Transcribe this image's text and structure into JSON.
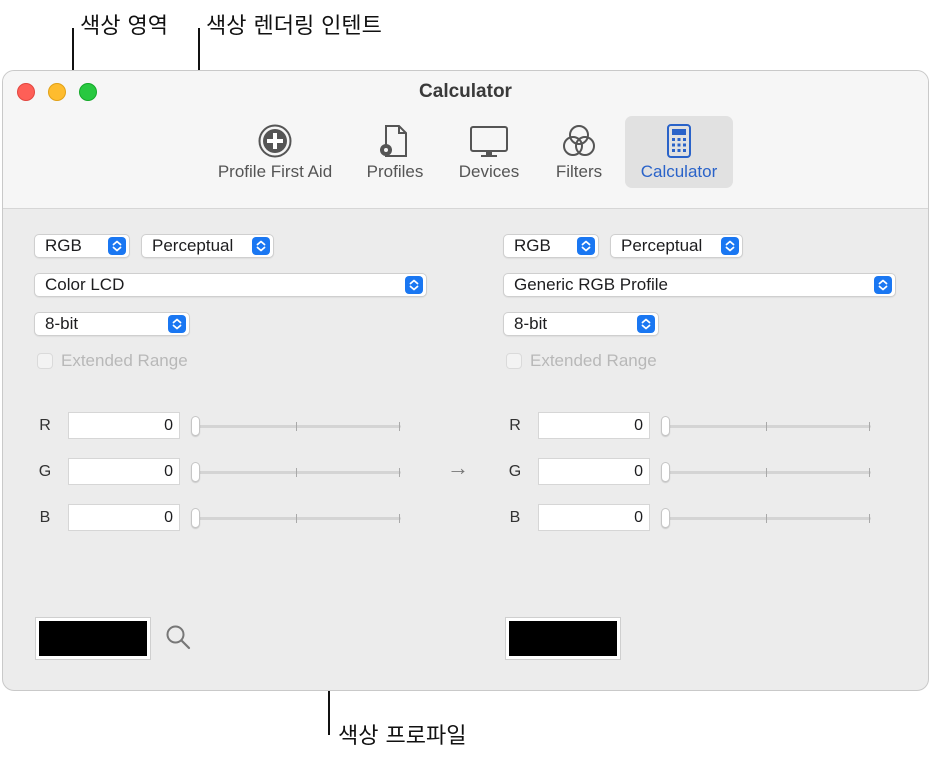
{
  "callouts": {
    "color_space": "색상 영역",
    "rendering_intent": "색상 렌더링 인텐트",
    "color_profile": "색상 프로파일"
  },
  "window": {
    "title": "Calculator"
  },
  "toolbar": {
    "items": [
      {
        "label": "Profile First Aid",
        "icon": "first-aid-icon"
      },
      {
        "label": "Profiles",
        "icon": "profiles-icon"
      },
      {
        "label": "Devices",
        "icon": "display-icon"
      },
      {
        "label": "Filters",
        "icon": "filters-icon"
      },
      {
        "label": "Calculator",
        "icon": "calculator-icon",
        "active": true
      }
    ]
  },
  "left": {
    "color_space": "RGB",
    "intent": "Perceptual",
    "profile": "Color LCD",
    "bit_depth": "8-bit",
    "extended_range": "Extended Range",
    "channels": [
      {
        "label": "R",
        "value": "0"
      },
      {
        "label": "G",
        "value": "0"
      },
      {
        "label": "B",
        "value": "0"
      }
    ]
  },
  "right": {
    "color_space": "RGB",
    "intent": "Perceptual",
    "profile": "Generic RGB Profile",
    "bit_depth": "8-bit",
    "extended_range": "Extended Range",
    "channels": [
      {
        "label": "R",
        "value": "0"
      },
      {
        "label": "G",
        "value": "0"
      },
      {
        "label": "B",
        "value": "0"
      }
    ]
  },
  "arrow": "→",
  "colors": {
    "accent": "#1a77f2",
    "swatch": "#000000"
  }
}
